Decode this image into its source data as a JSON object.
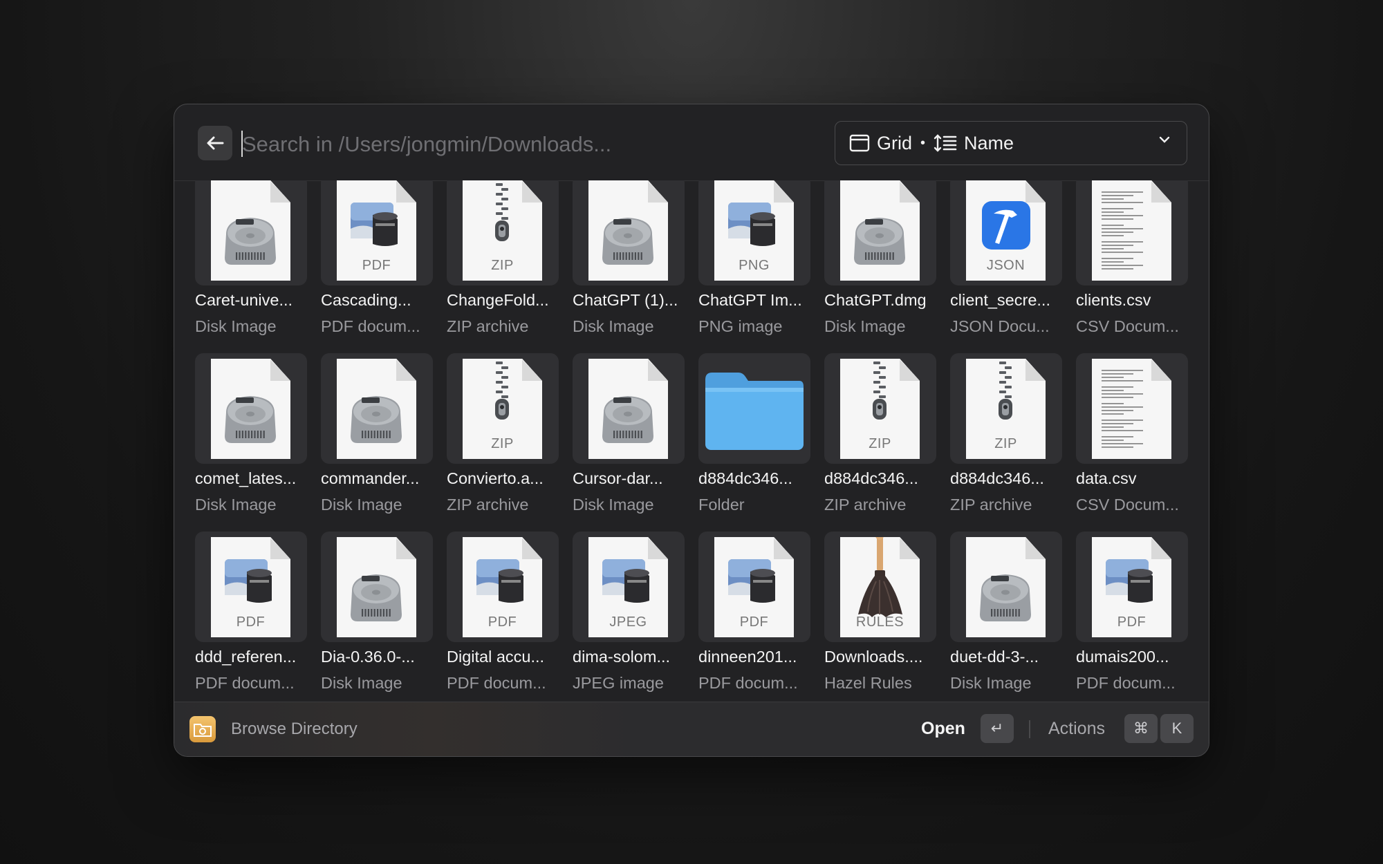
{
  "search": {
    "placeholder": "Search in /Users/jongmin/Downloads..."
  },
  "view": {
    "layout": "Grid",
    "separator": "•",
    "sort": "Name"
  },
  "items": [
    {
      "name": "Caret-unive...",
      "kind": "Disk Image",
      "icon": "disk-image-icon",
      "badge": ""
    },
    {
      "name": "Cascading...",
      "kind": "PDF docum...",
      "icon": "preview-icon",
      "badge": "PDF"
    },
    {
      "name": "ChangeFold...",
      "kind": "ZIP archive",
      "icon": "zipper-icon",
      "badge": "ZIP"
    },
    {
      "name": "ChatGPT (1)...",
      "kind": "Disk Image",
      "icon": "disk-image-icon",
      "badge": ""
    },
    {
      "name": "ChatGPT Im...",
      "kind": "PNG image",
      "icon": "preview-icon",
      "badge": "PNG"
    },
    {
      "name": "ChatGPT.dmg",
      "kind": "Disk Image",
      "icon": "disk-image-icon",
      "badge": ""
    },
    {
      "name": "client_secre...",
      "kind": "JSON Docu...",
      "icon": "xcode-hammer-icon",
      "badge": "JSON"
    },
    {
      "name": "clients.csv",
      "kind": "CSV Docum...",
      "icon": "text-document-icon",
      "badge": ""
    },
    {
      "name": "comet_lates...",
      "kind": "Disk Image",
      "icon": "disk-image-icon",
      "badge": ""
    },
    {
      "name": "commander...",
      "kind": "Disk Image",
      "icon": "disk-image-icon",
      "badge": ""
    },
    {
      "name": "Convierto.a...",
      "kind": "ZIP archive",
      "icon": "zipper-icon",
      "badge": "ZIP"
    },
    {
      "name": "Cursor-dar...",
      "kind": "Disk Image",
      "icon": "disk-image-icon",
      "badge": ""
    },
    {
      "name": "d884dc346...",
      "kind": "Folder",
      "icon": "folder-icon",
      "badge": ""
    },
    {
      "name": "d884dc346...",
      "kind": "ZIP archive",
      "icon": "zipper-icon",
      "badge": "ZIP"
    },
    {
      "name": "d884dc346...",
      "kind": "ZIP archive",
      "icon": "zipper-icon",
      "badge": "ZIP"
    },
    {
      "name": "data.csv",
      "kind": "CSV Docum...",
      "icon": "text-document-icon",
      "badge": ""
    },
    {
      "name": "ddd_referen...",
      "kind": "PDF docum...",
      "icon": "preview-icon",
      "badge": "PDF"
    },
    {
      "name": "Dia-0.36.0-...",
      "kind": "Disk Image",
      "icon": "disk-image-icon",
      "badge": ""
    },
    {
      "name": "Digital accu...",
      "kind": "PDF docum...",
      "icon": "preview-icon",
      "badge": "PDF"
    },
    {
      "name": "dima-solom...",
      "kind": "JPEG image",
      "icon": "preview-icon",
      "badge": "JPEG"
    },
    {
      "name": "dinneen201...",
      "kind": "PDF docum...",
      "icon": "preview-icon",
      "badge": "PDF"
    },
    {
      "name": "Downloads....",
      "kind": "Hazel Rules",
      "icon": "broom-icon",
      "badge": "RULES"
    },
    {
      "name": "duet-dd-3-...",
      "kind": "Disk Image",
      "icon": "disk-image-icon",
      "badge": ""
    },
    {
      "name": "dumais200...",
      "kind": "PDF docum...",
      "icon": "preview-icon",
      "badge": "PDF"
    }
  ],
  "footer": {
    "title": "Browse Directory",
    "open_label": "Open",
    "enter_key": "↵",
    "actions_label": "Actions",
    "cmd_key": "⌘",
    "k_key": "K"
  },
  "colors": {
    "background": "#1a1a1a",
    "window": "#222224",
    "tile": "#303033",
    "folder": "#5fb4f0"
  }
}
